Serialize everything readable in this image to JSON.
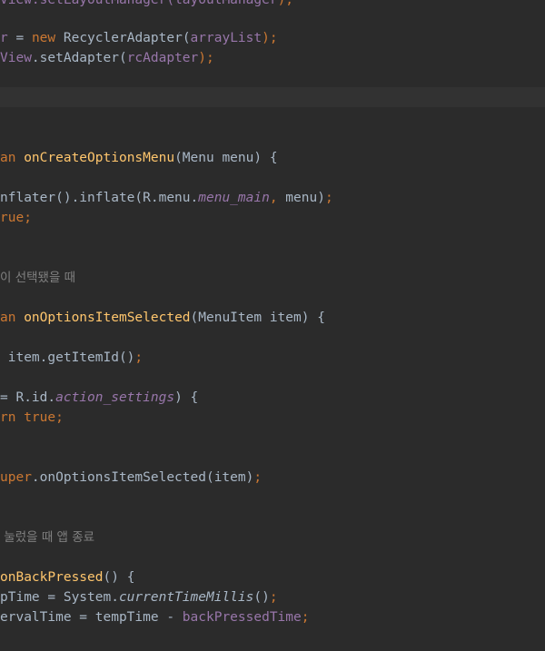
{
  "code_lines": [
    {
      "segments": [
        {
          "text": "View.setLayoutManager(",
          "c": "fld"
        },
        {
          "text": "layoutManager",
          "c": "fld"
        },
        {
          "text": ");",
          "c": "kw"
        }
      ]
    },
    {
      "segments": [
        {
          "text": "r",
          "c": "fld"
        },
        {
          "text": " = ",
          "c": "plain"
        },
        {
          "text": "new",
          "c": "kw"
        },
        {
          "text": " RecyclerAdapter(",
          "c": "plain"
        },
        {
          "text": "arrayList",
          "c": "fld"
        },
        {
          "text": ");",
          "c": "kw"
        }
      ]
    },
    {
      "segments": [
        {
          "text": "View",
          "c": "fld"
        },
        {
          "text": ".setAdapter(",
          "c": "plain"
        },
        {
          "text": "rcAdapter",
          "c": "fld"
        },
        {
          "text": ");",
          "c": "kw"
        }
      ]
    },
    {
      "segments": [
        {
          "text": "an",
          "c": "kw"
        },
        {
          "text": " ",
          "c": "plain"
        },
        {
          "text": "onCreateOptionsMenu",
          "c": "fn"
        },
        {
          "text": "(Menu menu) {",
          "c": "plain"
        }
      ]
    },
    {
      "segments": [
        {
          "text": "nflater().inflate(R.menu.",
          "c": "plain"
        },
        {
          "text": "menu_main",
          "c": "fld it"
        },
        {
          "text": ",",
          "c": "kw"
        },
        {
          "text": " menu)",
          "c": "plain"
        },
        {
          "text": ";",
          "c": "kw"
        }
      ]
    },
    {
      "segments": [
        {
          "text": "rue;",
          "c": "kw"
        }
      ]
    },
    {
      "segments": [
        {
          "text": "이 선택됐을 때",
          "c": "cm"
        }
      ]
    },
    {
      "segments": [
        {
          "text": "an",
          "c": "kw"
        },
        {
          "text": " ",
          "c": "plain"
        },
        {
          "text": "onOptionsItemSelected",
          "c": "fn"
        },
        {
          "text": "(MenuItem item) {",
          "c": "plain"
        }
      ]
    },
    {
      "segments": [
        {
          "text": " item.getItemId()",
          "c": "plain"
        },
        {
          "text": ";",
          "c": "kw"
        }
      ]
    },
    {
      "segments": [
        {
          "text": "= R.id.",
          "c": "plain"
        },
        {
          "text": "action_settings",
          "c": "fld it"
        },
        {
          "text": ") {",
          "c": "plain"
        }
      ]
    },
    {
      "segments": [
        {
          "text": "rn",
          "c": "kw"
        },
        {
          "text": " ",
          "c": "plain"
        },
        {
          "text": "true;",
          "c": "kw"
        }
      ]
    },
    {
      "segments": [
        {
          "text": "uper",
          "c": "kw"
        },
        {
          "text": ".onOptionsItemSelected(item)",
          "c": "plain"
        },
        {
          "text": ";",
          "c": "kw"
        }
      ]
    },
    {
      "segments": [
        {
          "text": " 눌렀을 때 앱 종료",
          "c": "cm"
        }
      ]
    },
    {
      "segments": [
        {
          "text": "onBackPressed",
          "c": "fn"
        },
        {
          "text": "() {",
          "c": "plain"
        }
      ]
    },
    {
      "segments": [
        {
          "text": "pTime = System.",
          "c": "plain"
        },
        {
          "text": "currentTimeMillis",
          "c": "it"
        },
        {
          "text": "()",
          "c": "plain"
        },
        {
          "text": ";",
          "c": "kw"
        }
      ]
    },
    {
      "segments": [
        {
          "text": "ervalTime = tempTime - ",
          "c": "plain"
        },
        {
          "text": "backPressedTime",
          "c": "fld"
        },
        {
          "text": ";",
          "c": "kw"
        }
      ]
    }
  ],
  "colors": {
    "background": "#2b2b2b",
    "keyword": "#cc7832",
    "method": "#ffc66d",
    "field": "#9876aa",
    "comment": "#808080",
    "text": "#a9b7c6"
  }
}
